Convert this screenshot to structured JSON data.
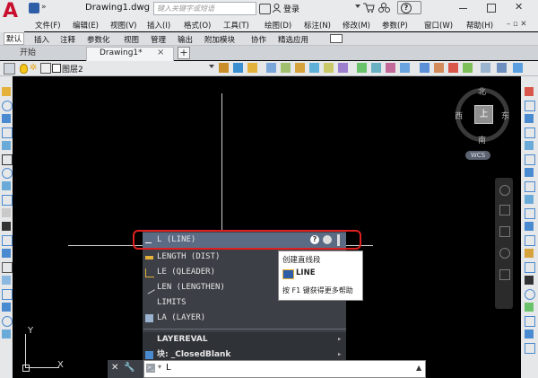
{
  "app": {
    "logo_letter": "A",
    "window_title": "Drawing1.dwg",
    "search_placeholder": "键入关键字或短语",
    "login_label": "登录",
    "help_label": "?"
  },
  "menubar": {
    "items": [
      "文件(F)",
      "编辑(E)",
      "视图(V)",
      "插入(I)",
      "格式(O)",
      "工具(T)",
      "绘图(D)",
      "标注(N)",
      "修改(M)",
      "参数(P)",
      "窗口(W)",
      "帮助(H)"
    ]
  },
  "ribbon": {
    "tabs": [
      "默认",
      "插入",
      "注释",
      "参数化",
      "视图",
      "管理",
      "输出",
      "附加模块",
      "协作",
      "精选应用"
    ]
  },
  "doctabs": {
    "start": "开始",
    "drawing": "Drawing1*",
    "close": "×",
    "add": "+"
  },
  "toolbar": {
    "layer_name": "图层2"
  },
  "viewcube": {
    "north": "北",
    "south": "南",
    "east": "东",
    "west": "西",
    "top": "上",
    "wcs": "WCS"
  },
  "autocomplete": {
    "items": [
      {
        "label": "L (LINE)",
        "selected": true
      },
      {
        "label": "LENGTH (DIST)"
      },
      {
        "label": "LE (QLEADER)"
      },
      {
        "label": "LEN (LENGTHEN)"
      },
      {
        "label": "LIMITS"
      },
      {
        "label": "LA (LAYER)"
      }
    ],
    "sections": [
      {
        "label": "LAYEREVAL"
      },
      {
        "label": "块: _ClosedBlank"
      }
    ],
    "section_arrow": "▸"
  },
  "tooltip": {
    "description": "创建直线段",
    "command": "LINE",
    "help_hint": "按 F1 键获得更多帮助"
  },
  "commandline": {
    "value": "L",
    "prompt_symbol": ">_"
  },
  "ucs": {
    "x_label": "X",
    "y_label": "Y"
  },
  "colors": {
    "accent_red": "#e02020",
    "canvas": "#000000",
    "panel": "#3c3f45",
    "selected_row": "#5b6b84"
  }
}
